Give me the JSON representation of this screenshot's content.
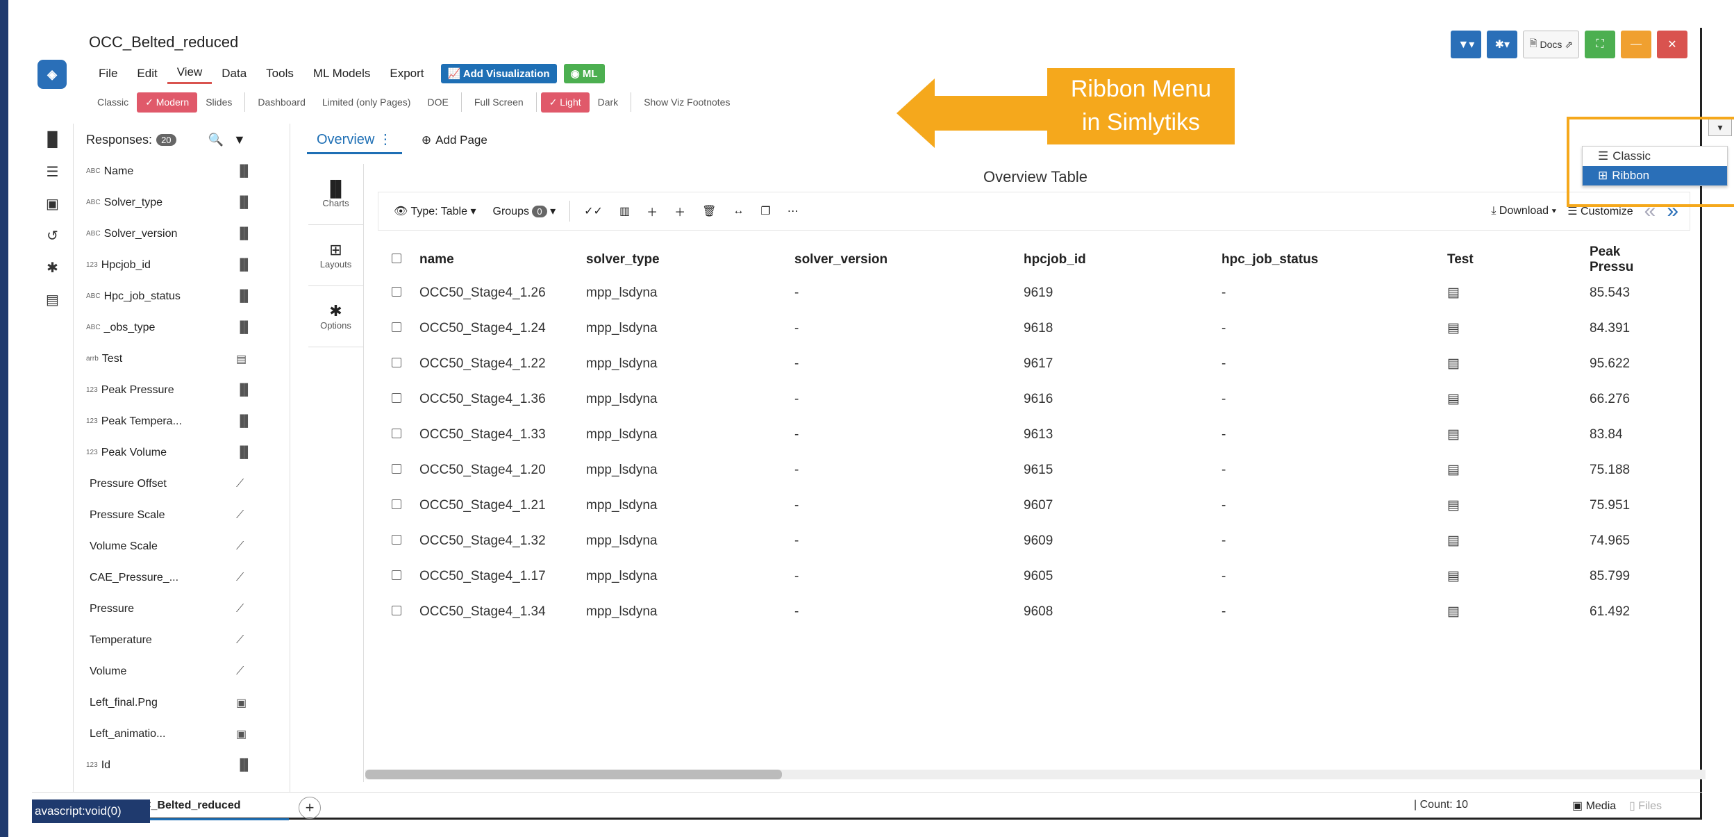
{
  "header": {
    "title": "OCC_Belted_reduced",
    "menu": [
      "File",
      "Edit",
      "View",
      "Data",
      "Tools",
      "ML Models",
      "Export"
    ],
    "add_visualization": "Add Visualization",
    "ml_button": "ML",
    "docs": "Docs"
  },
  "ribbon": {
    "items": [
      "Classic",
      "Modern",
      "Slides",
      "Dashboard",
      "Limited (only Pages)",
      "DOE",
      "Full Screen",
      "Light",
      "Dark",
      "Show Viz Footnotes"
    ],
    "selected": [
      "Modern",
      "Light"
    ]
  },
  "callout": {
    "line1": "Ribbon Menu",
    "line2": "in Simlytiks"
  },
  "view_menu": {
    "options": [
      "Classic",
      "Ribbon"
    ],
    "selected": "Ribbon"
  },
  "responses": {
    "label": "Responses:",
    "count": "20",
    "items": [
      {
        "type": "ABC",
        "name": "Name"
      },
      {
        "type": "ABC",
        "name": "Solver_type"
      },
      {
        "type": "ABC",
        "name": "Solver_version"
      },
      {
        "type": "123",
        "name": "Hpcjob_id"
      },
      {
        "type": "ABC",
        "name": "Hpc_job_status"
      },
      {
        "type": "ABC",
        "name": "_obs_type"
      },
      {
        "type": "arrb",
        "name": "Test"
      },
      {
        "type": "123",
        "name": "Peak Pressure"
      },
      {
        "type": "123",
        "name": "Peak Tempera..."
      },
      {
        "type": "123",
        "name": "Peak Volume"
      },
      {
        "type": "",
        "name": "Pressure Offset"
      },
      {
        "type": "",
        "name": "Pressure Scale"
      },
      {
        "type": "",
        "name": "Volume Scale"
      },
      {
        "type": "",
        "name": "CAE_Pressure_..."
      },
      {
        "type": "",
        "name": "Pressure"
      },
      {
        "type": "",
        "name": "Temperature"
      },
      {
        "type": "",
        "name": "Volume"
      },
      {
        "type": "",
        "name": "Left_final.Png"
      },
      {
        "type": "",
        "name": "Left_animatio..."
      },
      {
        "type": "123",
        "name": "Id"
      }
    ]
  },
  "main": {
    "tab": "Overview",
    "add_page": "Add Page",
    "side_tabs": [
      "Charts",
      "Layouts",
      "Options"
    ],
    "panel_title": "Overview Table",
    "toolbar": {
      "type": "Type: Table",
      "groups": "Groups",
      "groups_count": "0",
      "download": "Download",
      "customize": "Customize"
    },
    "table": {
      "headers": [
        "name",
        "solver_type",
        "solver_version",
        "hpcjob_id",
        "hpc_job_status",
        "Test",
        "Peak Pressu"
      ],
      "rows": [
        [
          "OCC50_Stage4_1.26",
          "mpp_lsdyna",
          "-",
          "9619",
          "-",
          "85.543"
        ],
        [
          "OCC50_Stage4_1.24",
          "mpp_lsdyna",
          "-",
          "9618",
          "-",
          "84.391"
        ],
        [
          "OCC50_Stage4_1.22",
          "mpp_lsdyna",
          "-",
          "9617",
          "-",
          "95.622"
        ],
        [
          "OCC50_Stage4_1.36",
          "mpp_lsdyna",
          "-",
          "9616",
          "-",
          "66.276"
        ],
        [
          "OCC50_Stage4_1.33",
          "mpp_lsdyna",
          "-",
          "9613",
          "-",
          "83.84"
        ],
        [
          "OCC50_Stage4_1.20",
          "mpp_lsdyna",
          "-",
          "9615",
          "-",
          "75.188"
        ],
        [
          "OCC50_Stage4_1.21",
          "mpp_lsdyna",
          "-",
          "9607",
          "-",
          "75.951"
        ],
        [
          "OCC50_Stage4_1.32",
          "mpp_lsdyna",
          "-",
          "9609",
          "-",
          "74.965"
        ],
        [
          "OCC50_Stage4_1.17",
          "mpp_lsdyna",
          "-",
          "9605",
          "-",
          "85.799"
        ],
        [
          "OCC50_Stage4_1.34",
          "mpp_lsdyna",
          "-",
          "9608",
          "-",
          "61.492"
        ]
      ]
    }
  },
  "bottom": {
    "tab": "C_Belted_reduced",
    "status_link": "avascript:void(0)",
    "count": "Count: 10",
    "media": "Media",
    "files": "Files"
  },
  "colors": {
    "accent": "#1e6fb5",
    "callout": "#f5a81c",
    "selected": "#e0596a"
  }
}
